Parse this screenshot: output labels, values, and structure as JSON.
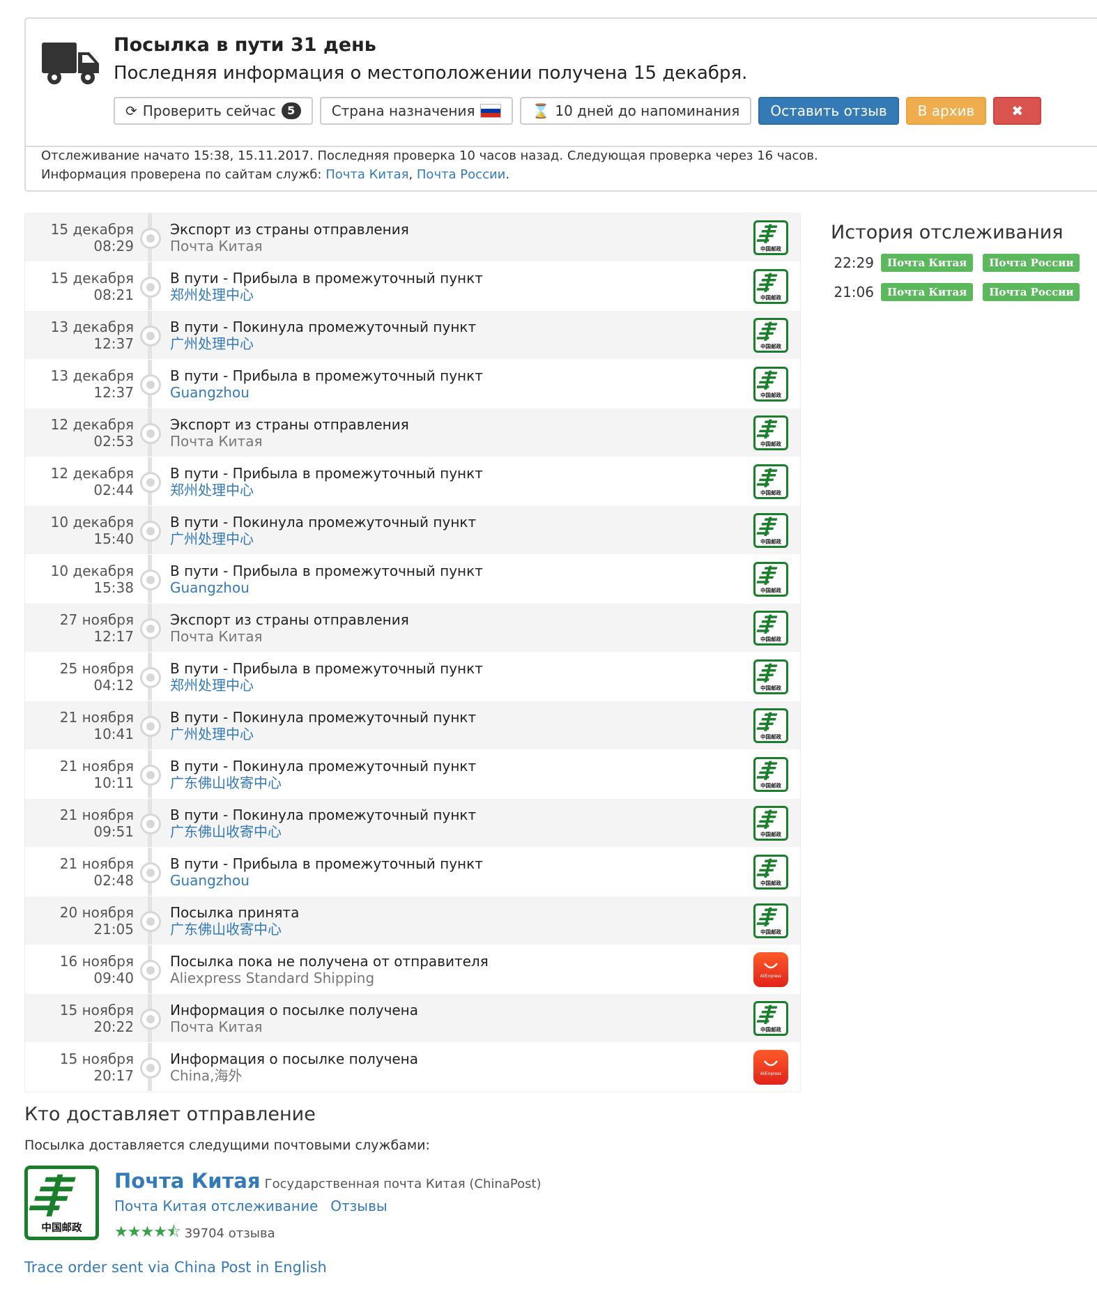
{
  "header": {
    "title": "Посылка в пути 31 день",
    "subtitle": "Последняя информация о местоположении получена 15 декабря.",
    "buttons": {
      "check_now": "Проверить сейчас",
      "check_count": "5",
      "destination": "Страна назначения",
      "reminder": "10 дней до напоминания",
      "review": "Оставить отзыв",
      "archive": "В архив",
      "close": "✖"
    },
    "info_line1": "Отслеживание начато 15:38, 15.11.2017. Последняя проверка 10 часов назад. Следующая проверка через 16 часов.",
    "info_line2_prefix": "Информация проверена по сайтам служб: ",
    "info_link1": "Почта Китая",
    "info_sep": ", ",
    "info_link2": "Почта России",
    "info_end": "."
  },
  "events": [
    {
      "date": "15 декабря",
      "time": "08:29",
      "title": "Экспорт из страны отправления",
      "sub": "Почта Китая",
      "sub_link": false,
      "logo": "china-post"
    },
    {
      "date": "15 декабря",
      "time": "08:21",
      "title": "В пути - Прибыла в промежуточный пункт",
      "sub": "郑州处理中心",
      "sub_link": true,
      "logo": "china-post"
    },
    {
      "date": "13 декабря",
      "time": "12:37",
      "title": "В пути - Покинула промежуточный пункт",
      "sub": "广州处理中心",
      "sub_link": true,
      "logo": "china-post"
    },
    {
      "date": "13 декабря",
      "time": "12:37",
      "title": "В пути - Прибыла в промежуточный пункт",
      "sub": "Guangzhou",
      "sub_link": true,
      "logo": "china-post"
    },
    {
      "date": "12 декабря",
      "time": "02:53",
      "title": "Экспорт из страны отправления",
      "sub": "Почта Китая",
      "sub_link": false,
      "logo": "china-post"
    },
    {
      "date": "12 декабря",
      "time": "02:44",
      "title": "В пути - Прибыла в промежуточный пункт",
      "sub": "郑州处理中心",
      "sub_link": true,
      "logo": "china-post"
    },
    {
      "date": "10 декабря",
      "time": "15:40",
      "title": "В пути - Покинула промежуточный пункт",
      "sub": "广州处理中心",
      "sub_link": true,
      "logo": "china-post"
    },
    {
      "date": "10 декабря",
      "time": "15:38",
      "title": "В пути - Прибыла в промежуточный пункт",
      "sub": "Guangzhou",
      "sub_link": true,
      "logo": "china-post"
    },
    {
      "date": "27 ноября",
      "time": "12:17",
      "title": "Экспорт из страны отправления",
      "sub": "Почта Китая",
      "sub_link": false,
      "logo": "china-post"
    },
    {
      "date": "25 ноября",
      "time": "04:12",
      "title": "В пути - Прибыла в промежуточный пункт",
      "sub": "郑州处理中心",
      "sub_link": true,
      "logo": "china-post"
    },
    {
      "date": "21 ноября",
      "time": "10:41",
      "title": "В пути - Покинула промежуточный пункт",
      "sub": "广州处理中心",
      "sub_link": true,
      "logo": "china-post"
    },
    {
      "date": "21 ноября",
      "time": "10:11",
      "title": "В пути - Покинула промежуточный пункт",
      "sub": "广东佛山收寄中心",
      "sub_link": true,
      "logo": "china-post"
    },
    {
      "date": "21 ноября",
      "time": "09:51",
      "title": "В пути - Покинула промежуточный пункт",
      "sub": "广东佛山收寄中心",
      "sub_link": true,
      "logo": "china-post"
    },
    {
      "date": "21 ноября",
      "time": "02:48",
      "title": "В пути - Прибыла в промежуточный пункт",
      "sub": "Guangzhou",
      "sub_link": true,
      "logo": "china-post"
    },
    {
      "date": "20 ноября",
      "time": "21:05",
      "title": "Посылка принята",
      "sub": "广东佛山收寄中心",
      "sub_link": true,
      "logo": "china-post"
    },
    {
      "date": "16 ноября",
      "time": "09:40",
      "title": "Посылка пока не получена от отправителя",
      "sub": "Aliexpress Standard Shipping",
      "sub_link": false,
      "logo": "aliexpress"
    },
    {
      "date": "15 ноября",
      "time": "20:22",
      "title": "Информация о посылке получена",
      "sub": "Почта Китая",
      "sub_link": false,
      "logo": "china-post"
    },
    {
      "date": "15 ноября",
      "time": "20:17",
      "title": "Информация о посылке получена",
      "sub": "China,海外",
      "sub_link": false,
      "logo": "aliexpress"
    }
  ],
  "history": {
    "title": "История отслеживания",
    "rows": [
      {
        "time": "22:29",
        "labels": [
          "Почта Китая",
          "Почта России"
        ]
      },
      {
        "time": "21:06",
        "labels": [
          "Почта Китая",
          "Почта России"
        ]
      }
    ]
  },
  "carriers": {
    "title": "Кто доставляет отправление",
    "subtitle": "Посылка доставляется следущими почтовыми службами:",
    "name": "Почта Китая",
    "description": "Государственная почта Китая (ChinaPost)",
    "link_tracking": "Почта Китая отслеживание",
    "link_reviews": "Отзывы",
    "rating": 4.5,
    "reviews_count": "39704 отзыва",
    "logo_text": "中国邮政"
  },
  "footer_link": "Trace order sent via China Post in English",
  "logo_texts": {
    "china_post_small": "中国邮政",
    "aliexpress": "AliExpress"
  },
  "colors": {
    "link": "#337ab7",
    "green": "#5cb85c",
    "china_post": "#1a7f2a",
    "orange": "#f0ad4e",
    "red": "#d9534f",
    "blue": "#337ab7"
  }
}
